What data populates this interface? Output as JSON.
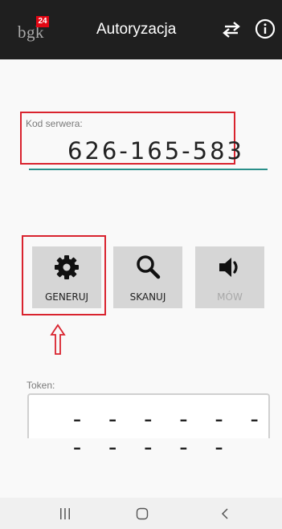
{
  "header": {
    "logo_text": "bgk",
    "logo_badge": "24",
    "title": "Autoryzacja",
    "icons": [
      "swap-arrows-icon",
      "info-icon"
    ]
  },
  "server": {
    "label": "Kod serwera:",
    "value": "626-165-583"
  },
  "buttons": {
    "generate": "GENERUJ",
    "scan": "SKANUJ",
    "speak": "MÓW"
  },
  "token": {
    "label": "Token:",
    "value": "- - - - - - - - - - -"
  },
  "colors": {
    "topbar": "#1f1f1f",
    "highlight": "#d9232e",
    "underline": "#2a8f8a",
    "button": "#d6d6d6",
    "badge": "#e30613"
  },
  "navbar": {
    "icons": [
      "recent-apps-icon",
      "home-icon",
      "back-icon"
    ]
  }
}
